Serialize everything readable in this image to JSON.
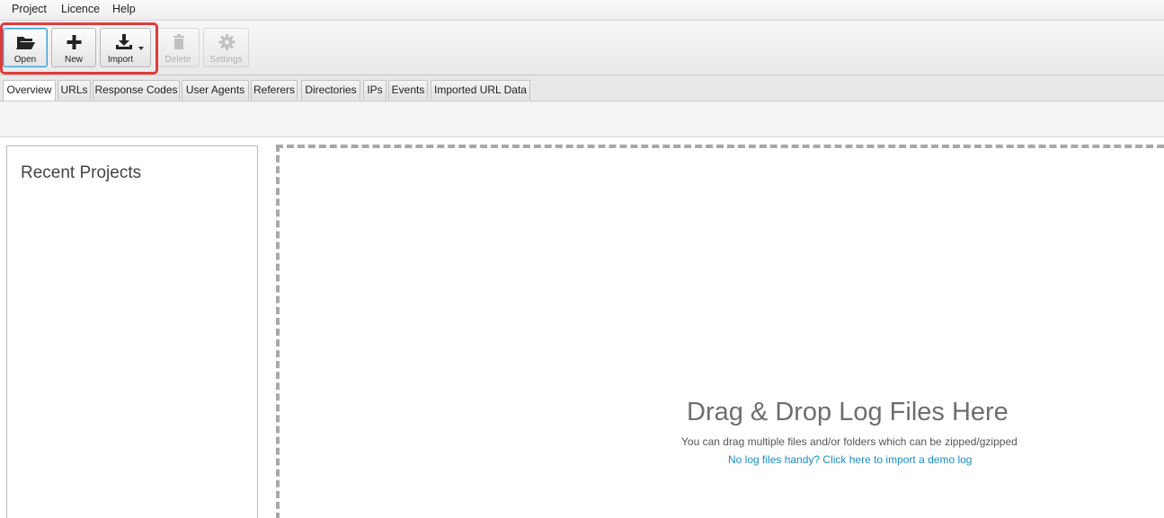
{
  "menu": {
    "items": [
      {
        "label": "Project"
      },
      {
        "label": "Licence"
      },
      {
        "label": "Help"
      }
    ]
  },
  "toolbar": {
    "open_label": "Open",
    "new_label": "New",
    "import_label": "Import",
    "delete_label": "Delete",
    "settings_label": "Settings"
  },
  "tabs": [
    {
      "label": "Overview"
    },
    {
      "label": "URLs"
    },
    {
      "label": "Response Codes"
    },
    {
      "label": "User Agents"
    },
    {
      "label": "Referers"
    },
    {
      "label": "Directories"
    },
    {
      "label": "IPs"
    },
    {
      "label": "Events"
    },
    {
      "label": "Imported URL Data"
    }
  ],
  "recent": {
    "title": "Recent Projects"
  },
  "dropzone": {
    "title": "Drag & Drop Log Files Here",
    "subtitle": "You can drag multiple files and/or folders which can be zipped/gzipped",
    "demo_link": "No log files handy? Click here to import a demo log"
  },
  "colors": {
    "highlight": "#e23a3a",
    "link": "#1a8cc8",
    "active_border": "#3c9bd6"
  },
  "icons": {
    "open": "folder-open-icon",
    "new": "plus-icon",
    "import": "download-icon",
    "delete": "trash-icon",
    "settings": "gear-icon"
  }
}
